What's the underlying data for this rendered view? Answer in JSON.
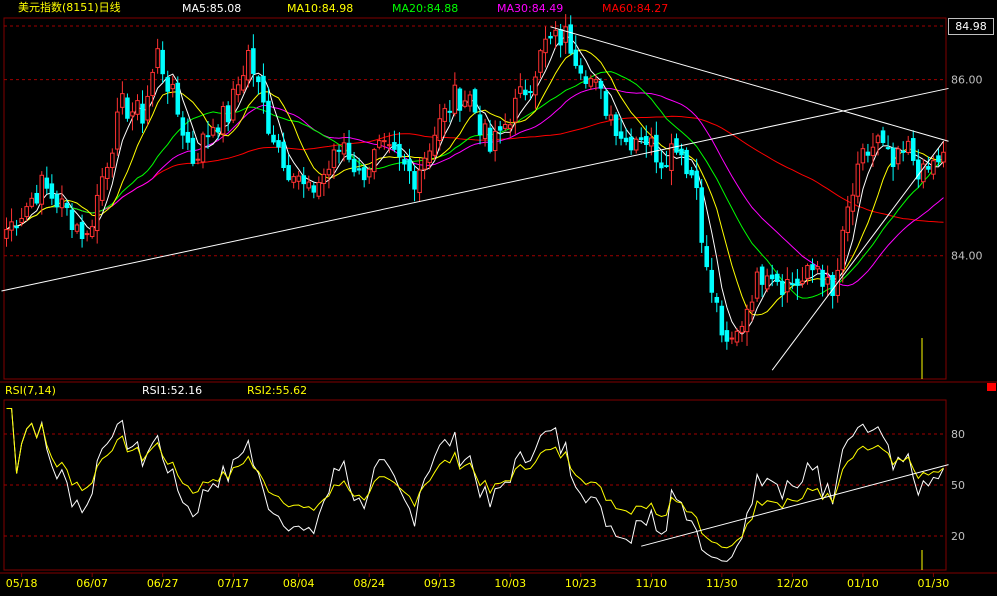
{
  "header": {
    "title": "美元指数(8151)日线",
    "ma": [
      {
        "label": "MA5:85.08",
        "color": "#ffffff"
      },
      {
        "label": "MA10:84.98",
        "color": "#ffff00"
      },
      {
        "label": "MA20:84.88",
        "color": "#00ff00"
      },
      {
        "label": "MA30:84.49",
        "color": "#ff00ff"
      },
      {
        "label": "MA60:84.27",
        "color": "#ff0000"
      }
    ]
  },
  "price_axis": {
    "current_label": "84.98"
  },
  "rsi": {
    "title": "RSI(7,14)",
    "rsi1_label": "RSI1:52.16",
    "rsi2_label": "RSI2:55.62"
  },
  "chart_data": [
    {
      "type": "candlestick",
      "ylim": [
        82.6,
        86.7
      ],
      "yticks": [
        {
          "value": 86.0,
          "label": "86.00"
        },
        {
          "value": 84.0,
          "label": "84.00"
        }
      ],
      "xticks": [
        {
          "index": 3,
          "label": "05/18"
        },
        {
          "index": 17,
          "label": "06/07"
        },
        {
          "index": 31,
          "label": "06/27"
        },
        {
          "index": 45,
          "label": "07/17"
        },
        {
          "index": 58,
          "label": "08/04"
        },
        {
          "index": 72,
          "label": "08/24"
        },
        {
          "index": 86,
          "label": "09/13"
        },
        {
          "index": 100,
          "label": "10/03"
        },
        {
          "index": 114,
          "label": "10/23"
        },
        {
          "index": 128,
          "label": "11/10"
        },
        {
          "index": 142,
          "label": "11/30"
        },
        {
          "index": 156,
          "label": "12/20"
        },
        {
          "index": 170,
          "label": "01/10"
        },
        {
          "index": 184,
          "label": "01/30"
        }
      ],
      "close_anchors": [
        [
          0,
          84.3
        ],
        [
          3,
          84.5
        ],
        [
          7,
          84.8
        ],
        [
          12,
          84.5
        ],
        [
          16,
          84.2
        ],
        [
          19,
          84.9
        ],
        [
          23,
          85.7
        ],
        [
          27,
          85.6
        ],
        [
          30,
          86.3
        ],
        [
          33,
          85.8
        ],
        [
          37,
          85.1
        ],
        [
          41,
          85.5
        ],
        [
          44,
          85.6
        ],
        [
          48,
          86.3
        ],
        [
          52,
          85.5
        ],
        [
          56,
          85.0
        ],
        [
          60,
          84.7
        ],
        [
          64,
          85.0
        ],
        [
          67,
          85.3
        ],
        [
          70,
          84.9
        ],
        [
          74,
          85.2
        ],
        [
          77,
          85.1
        ],
        [
          81,
          84.9
        ],
        [
          85,
          85.4
        ],
        [
          89,
          85.8
        ],
        [
          92,
          85.8
        ],
        [
          96,
          85.2
        ],
        [
          100,
          85.6
        ],
        [
          104,
          86.0
        ],
        [
          107,
          86.4
        ],
        [
          111,
          86.5
        ],
        [
          114,
          86.2
        ],
        [
          117,
          85.9
        ],
        [
          120,
          85.6
        ],
        [
          123,
          85.3
        ],
        [
          126,
          85.4
        ],
        [
          130,
          85.1
        ],
        [
          133,
          85.3
        ],
        [
          137,
          84.8
        ],
        [
          139,
          83.8
        ],
        [
          141,
          83.4
        ],
        [
          143,
          82.9
        ],
        [
          145,
          83.1
        ],
        [
          148,
          83.6
        ],
        [
          151,
          83.9
        ],
        [
          154,
          83.7
        ],
        [
          158,
          83.7
        ],
        [
          161,
          83.9
        ],
        [
          164,
          83.5
        ],
        [
          167,
          84.5
        ],
        [
          170,
          85.1
        ],
        [
          173,
          85.3
        ],
        [
          176,
          85.0
        ],
        [
          179,
          85.2
        ],
        [
          182,
          84.9
        ],
        [
          185,
          85.1
        ]
      ],
      "volatility": 0.1
    },
    {
      "type": "line",
      "name": "RSI",
      "ylim": [
        0,
        100
      ],
      "yticks": [
        {
          "value": 80,
          "label": "80"
        },
        {
          "value": 50,
          "label": "50"
        },
        {
          "value": 20,
          "label": "20"
        }
      ]
    }
  ]
}
